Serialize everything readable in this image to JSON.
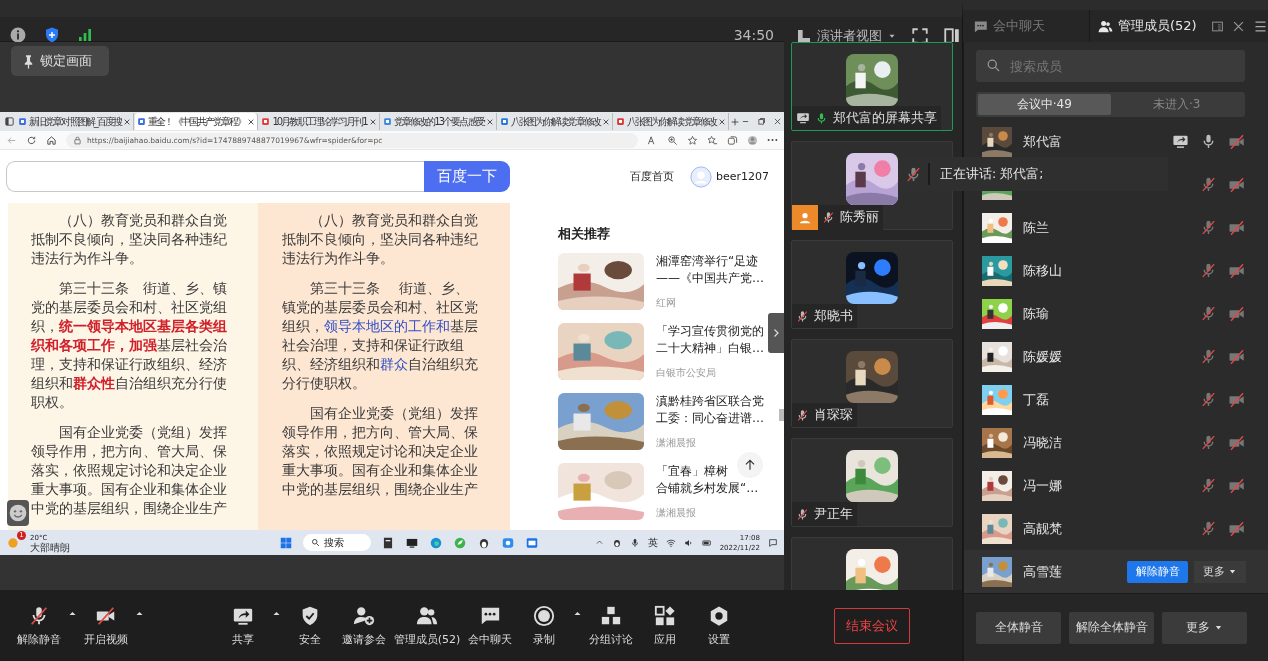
{
  "top_bar": {
    "timer": "34:50"
  },
  "lock_button": "锁定画面",
  "browser": {
    "tabs": [
      {
        "label": "新旧党章对照图解_百度搜",
        "selected": false
      },
      {
        "label": "重全！《中国共产党章程》",
        "selected": true
      },
      {
        "label": "10月教职工理论学习月刊1",
        "selected": false
      },
      {
        "label": "党章修改的13个要点感受",
        "selected": false
      },
      {
        "label": "八张图为你解读党章修改",
        "selected": false
      },
      {
        "label": "八张图为你解读党章修改",
        "selected": false
      }
    ],
    "url": "https://baijiahao.baidu.com/s?id=1747889748877019967&wfr=spider&for=pc",
    "search_button": "百度一下",
    "home_link": "百度首页",
    "username": "beer1207",
    "document_columns": [
      {
        "paragraphs": [
          "（八）教育党员和群众自觉抵制不良倾向，坚决同各种违纪违法行为作斗争。",
          "第三十三条　街道、乡、镇党的基层委员会和村、社区党组织，**统一领导本地区基层各类组织和各项工作，加强**基层社会治理，支持和保证行政组织、经济组织和**群众性**自治组织充分行使职权。",
          "国有企业党委（党组）发挥领导作用，把方向、管大局、保落实，依照规定讨论和决定企业重大事项。国有企业和集体企业中党的基层组织，围绕企业生产"
        ]
      },
      {
        "paragraphs": [
          "（八）教育党员和群众自觉抵制不良倾向，坚决同各种违纪违法行为作斗争。",
          "第三十三条　 街道、乡、镇党的基层委员会和村、社区党组织，**领导本地区的工作和**基层社会治理，支持和保证行政组织、经济组织和**群众**自治组织充分行使职权。",
          "国有企业党委（党组）发挥领导作用，把方向、管大局、保落实，依照规定讨论和决定企业重大事项。国有企业和集体企业中党的基层组织，围绕企业生产"
        ]
      }
    ],
    "related": {
      "title": "相关推荐",
      "items": [
        {
          "lines": [
            "湘潭窑湾举行“足迹",
            "——《中国共产党…"
          ],
          "source": "红网"
        },
        {
          "lines": [
            "「学习宣传贯彻党的",
            "二十大精神」白银…"
          ],
          "source": "白银市公安局"
        },
        {
          "lines": [
            "滇黔桂跨省区联合党",
            "工委：同心奋进谱…"
          ],
          "source": "潇湘晨报"
        },
        {
          "lines": [
            "「宜春」樟树",
            "合铺就乡村发展“…"
          ],
          "source": "潇湘晨报"
        }
      ]
    },
    "taskbar": {
      "badge": "1",
      "temperature": "20°C",
      "weather": "大部晴朗",
      "search": "搜索",
      "ime": "英",
      "time": "17:08",
      "date": "2022/11/22"
    }
  },
  "presenter_view": {
    "label": "演讲者视图"
  },
  "video_tiles": [
    {
      "kind": "share",
      "name": "郑代富的屏幕共享",
      "selected": true,
      "muted": false,
      "host": false
    },
    {
      "kind": "member",
      "name": "陈秀丽",
      "selected": false,
      "muted": true,
      "host": true
    },
    {
      "kind": "member",
      "name": "郑晓书",
      "selected": false,
      "muted": true,
      "host": false
    },
    {
      "kind": "member",
      "name": "肖琛琛",
      "selected": false,
      "muted": true,
      "host": false
    },
    {
      "kind": "member",
      "name": "尹正年",
      "selected": false,
      "muted": true,
      "host": false
    },
    {
      "selected": false
    }
  ],
  "speaking_tooltip": {
    "text": "正在讲话: 郑代富;",
    "muted": true
  },
  "panel": {
    "tabs": [
      {
        "label": "会中聊天",
        "selected": false
      },
      {
        "label": "管理成员(52)",
        "selected": true
      }
    ],
    "search_placeholder": "搜索成员",
    "segments": [
      {
        "label": "会议中·49",
        "selected": true
      },
      {
        "label": "未进入·3",
        "selected": false
      }
    ],
    "members": [
      {
        "name": "郑代富",
        "sharing": true,
        "muted": false,
        "camera_on": false,
        "hovered": false
      },
      {
        "sharing": false,
        "muted": true,
        "camera_on": false,
        "hovered": false
      },
      {
        "name": "陈兰",
        "sharing": false,
        "muted": true,
        "camera_on": false,
        "hovered": false
      },
      {
        "name": "陈移山",
        "sharing": false,
        "muted": true,
        "camera_on": false,
        "hovered": false
      },
      {
        "name": "陈瑜",
        "sharing": false,
        "muted": true,
        "camera_on": false,
        "hovered": false
      },
      {
        "name": "陈媛媛",
        "sharing": false,
        "muted": true,
        "camera_on": false,
        "hovered": false
      },
      {
        "name": "丁磊",
        "sharing": false,
        "muted": true,
        "camera_on": false,
        "hovered": false
      },
      {
        "name": "冯晓洁",
        "sharing": false,
        "muted": true,
        "camera_on": false,
        "hovered": false
      },
      {
        "name": "冯一娜",
        "sharing": false,
        "muted": true,
        "camera_on": false,
        "hovered": false
      },
      {
        "name": "高靓梵",
        "sharing": false,
        "muted": true,
        "camera_on": false,
        "hovered": false
      },
      {
        "name": "高雪莲",
        "sharing": false,
        "hovered": true
      }
    ],
    "hover_actions": {
      "unmute": "解除静音",
      "more": "更多"
    },
    "footer_buttons": [
      "全体静音",
      "解除全体静音",
      "更多"
    ]
  },
  "toolbar": {
    "items": [
      {
        "kind": "mic",
        "label": "解除静音",
        "muted": true,
        "caret": true
      },
      {
        "kind": "video",
        "label": "开启视频",
        "on": false,
        "caret": true
      },
      {
        "kind": "share",
        "label": "共享",
        "caret": true
      },
      {
        "kind": "security",
        "label": "安全",
        "caret": false
      },
      {
        "kind": "invite",
        "label": "邀请参会",
        "caret": false
      },
      {
        "kind": "members",
        "label": "管理成员(52)",
        "caret": false
      },
      {
        "kind": "chat",
        "label": "会中聊天",
        "caret": false
      },
      {
        "kind": "record",
        "label": "录制",
        "caret": true
      },
      {
        "kind": "breakout",
        "label": "分组讨论",
        "caret": false
      },
      {
        "kind": "apps",
        "label": "应用",
        "caret": false
      },
      {
        "kind": "settings",
        "label": "设置",
        "caret": false
      }
    ],
    "end_button": "结束会议"
  }
}
